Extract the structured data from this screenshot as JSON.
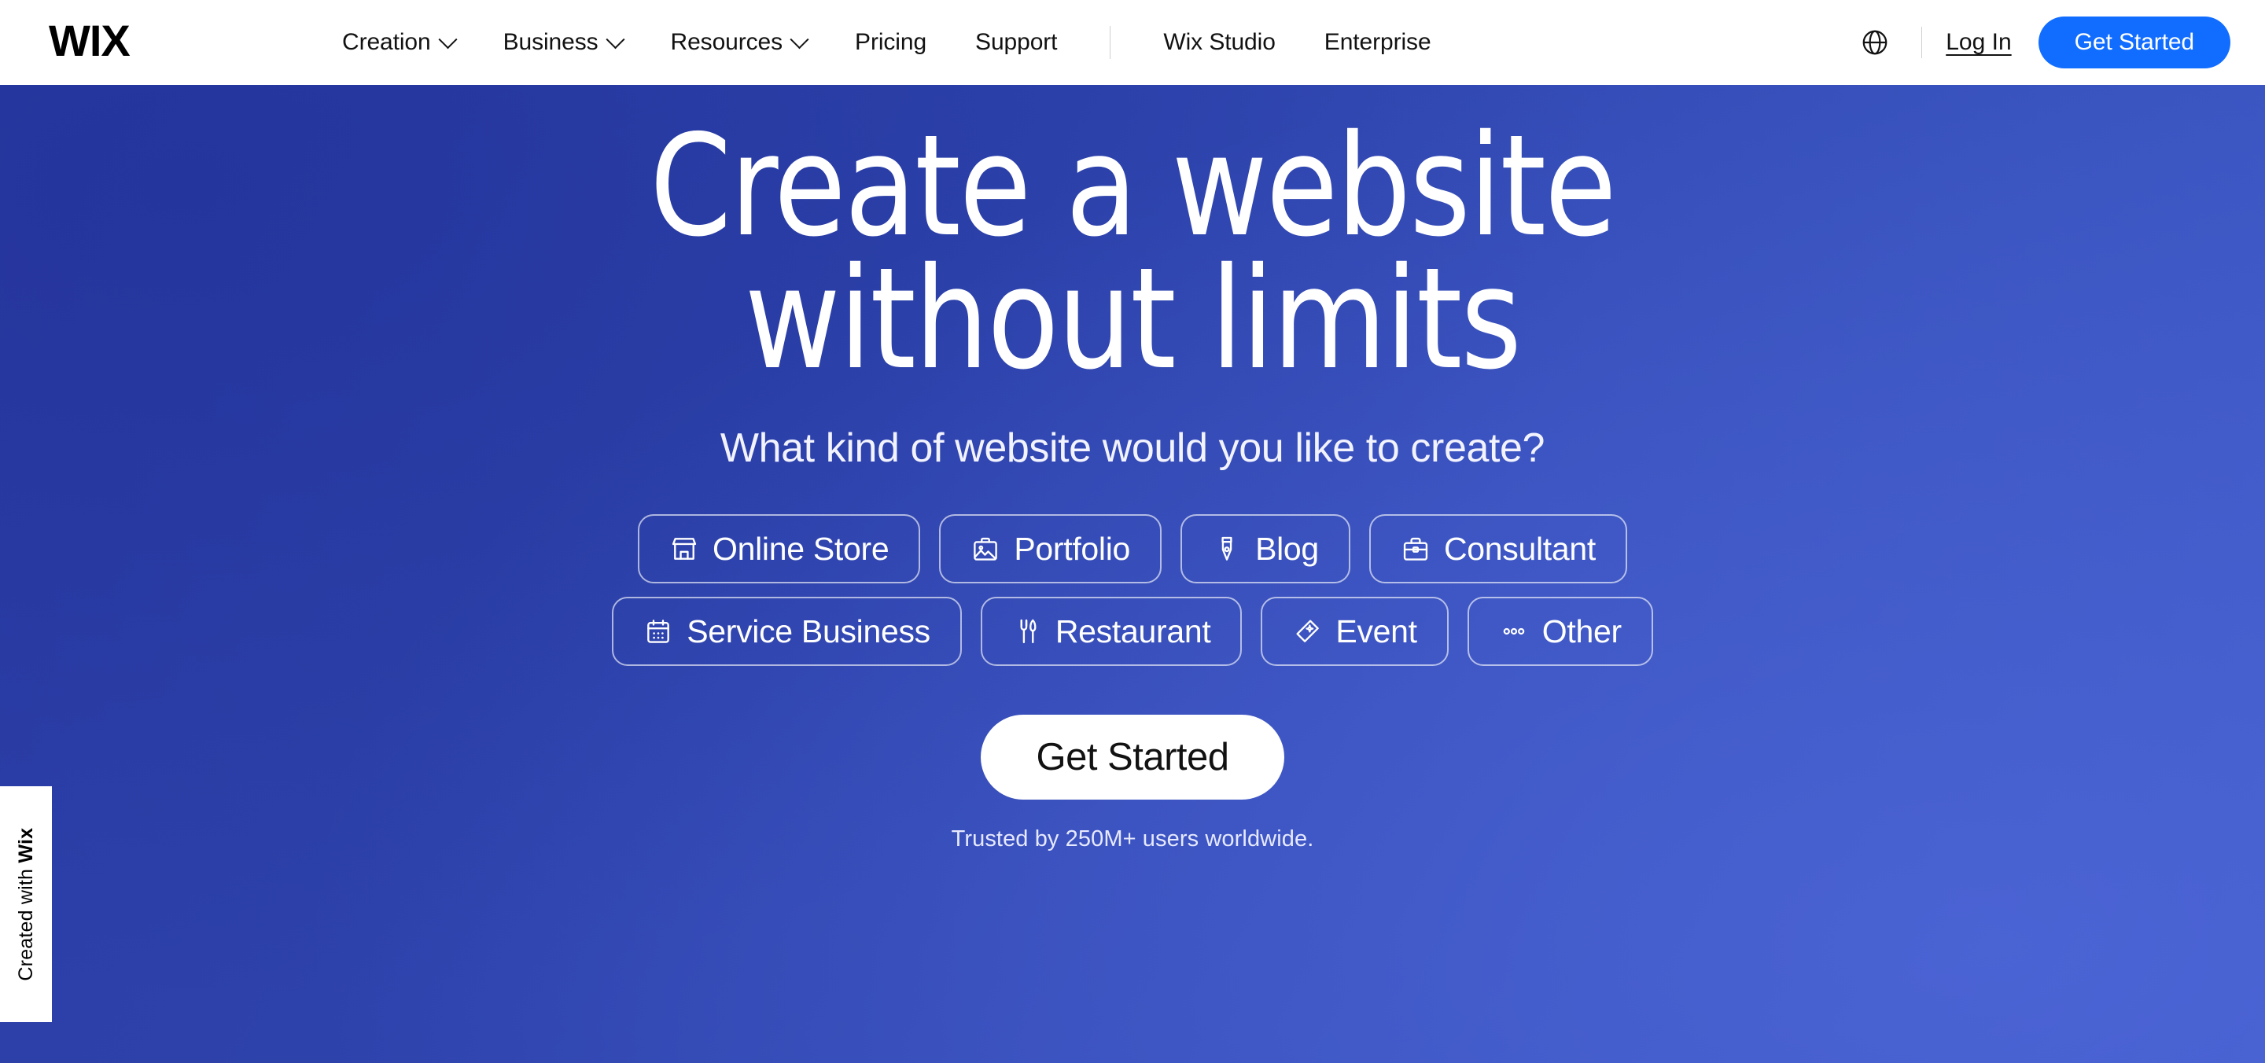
{
  "brand": {
    "logo_text": "WIX",
    "accent_blue": "#116dff",
    "hero_blue_dark": "#2b3ba4",
    "hero_blue_light": "#3f5ac7"
  },
  "header": {
    "nav_primary": [
      {
        "label": "Creation",
        "icon": "chevron-down-icon",
        "has_dropdown": true
      },
      {
        "label": "Business",
        "icon": "chevron-down-icon",
        "has_dropdown": true
      },
      {
        "label": "Resources",
        "icon": "chevron-down-icon",
        "has_dropdown": true
      },
      {
        "label": "Pricing",
        "has_dropdown": false
      },
      {
        "label": "Support",
        "has_dropdown": false
      }
    ],
    "nav_secondary": [
      {
        "label": "Wix Studio"
      },
      {
        "label": "Enterprise"
      }
    ],
    "language_icon": "globe-icon",
    "login_label": "Log In",
    "get_started_label": "Get Started"
  },
  "hero": {
    "headline_line1": "Create a website",
    "headline_line2": "without limits",
    "subheadline": "What kind of website would you like to create?",
    "chip_rows": [
      [
        {
          "label": "Online Store",
          "icon": "store-icon"
        },
        {
          "label": "Portfolio",
          "icon": "portfolio-image-icon"
        },
        {
          "label": "Blog",
          "icon": "pen-nib-icon"
        },
        {
          "label": "Consultant",
          "icon": "briefcase-icon"
        }
      ],
      [
        {
          "label": "Service Business",
          "icon": "calendar-icon"
        },
        {
          "label": "Restaurant",
          "icon": "fork-knife-icon"
        },
        {
          "label": "Event",
          "icon": "ticket-icon"
        },
        {
          "label": "Other",
          "icon": "ellipsis-icon"
        }
      ]
    ],
    "cta_label": "Get Started",
    "trusted_text": "Trusted by 250M+ users worldwide."
  },
  "badge": {
    "prefix": "Created with",
    "brand": "Wix"
  }
}
